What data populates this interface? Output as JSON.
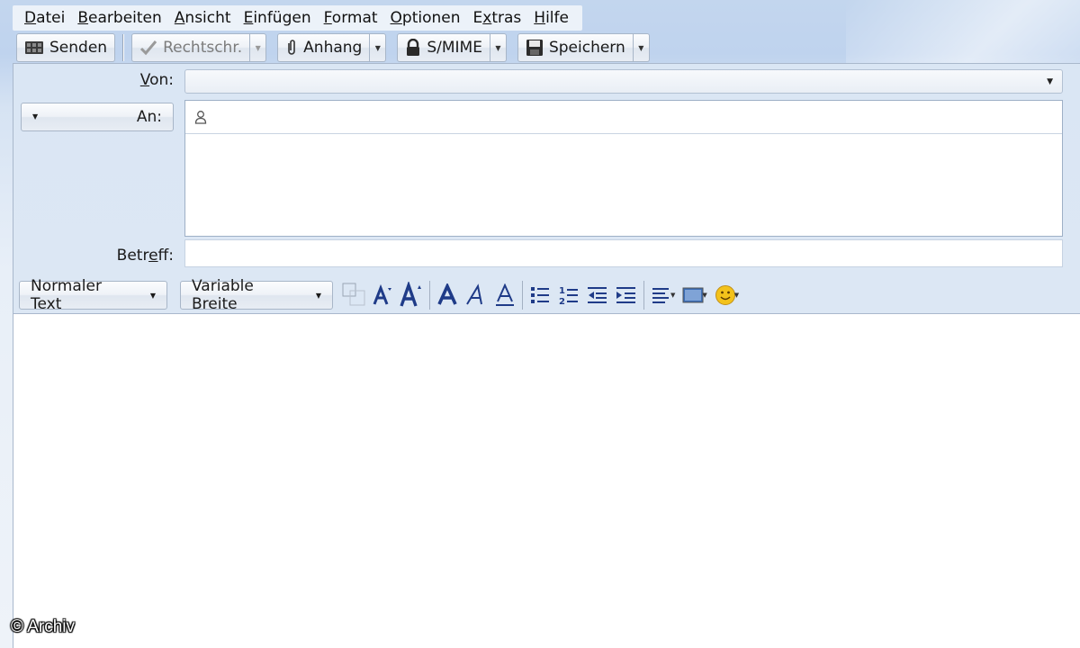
{
  "menu": [
    {
      "pre": "",
      "acc": "D",
      "post": "atei"
    },
    {
      "pre": "",
      "acc": "B",
      "post": "earbeiten"
    },
    {
      "pre": "",
      "acc": "A",
      "post": "nsicht"
    },
    {
      "pre": "",
      "acc": "E",
      "post": "infügen"
    },
    {
      "pre": "",
      "acc": "F",
      "post": "ormat"
    },
    {
      "pre": "",
      "acc": "O",
      "post": "ptionen"
    },
    {
      "pre": "E",
      "acc": "x",
      "post": "tras"
    },
    {
      "pre": "",
      "acc": "H",
      "post": "ilfe"
    }
  ],
  "toolbar": {
    "send": "Senden",
    "spell": "Rechtschr.",
    "attach": "Anhang",
    "smime": "S/MIME",
    "save": "Speichern"
  },
  "header": {
    "from_label_acc": "V",
    "from_label_rest": "on:",
    "from_value": "",
    "to_label": "An:",
    "subject_pre": "Betr",
    "subject_acc": "e",
    "subject_post": "ff:",
    "subject_value": ""
  },
  "format": {
    "paragraph_style": "Normaler Text",
    "font": "Variable Breite"
  },
  "body_text": "",
  "watermark": "© Archiv",
  "colors": {
    "icon_blue": "#1f3b88",
    "smiley": "#f3c21b"
  }
}
